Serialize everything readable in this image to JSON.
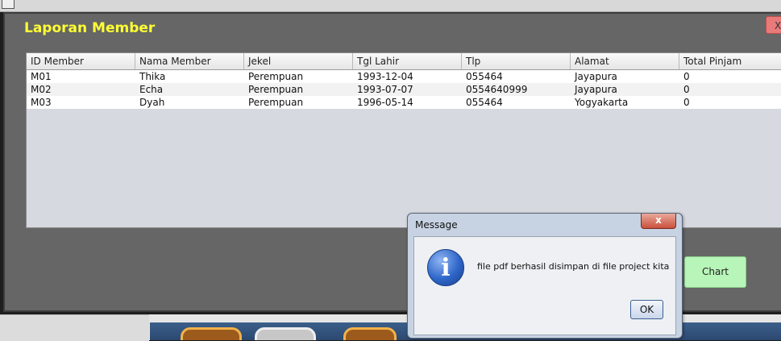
{
  "window": {
    "title": "Laporan Member",
    "close_label": "X"
  },
  "table": {
    "columns": [
      "ID Member",
      "Nama Member",
      "Jekel",
      "Tgl Lahir",
      "Tlp",
      "Alamat",
      "Total Pinjam"
    ],
    "rows": [
      [
        "M01",
        "Thika",
        "Perempuan",
        "1993-12-04",
        "055464",
        "Jayapura",
        "0"
      ],
      [
        "M02",
        "Echa",
        "Perempuan",
        "1993-07-07",
        "0554640999",
        "Jayapura",
        "0"
      ],
      [
        "M03",
        "Dyah",
        "Perempuan",
        "1996-05-14",
        "055464",
        "Yogyakarta",
        "0"
      ]
    ]
  },
  "buttons": {
    "chart_label": "Chart"
  },
  "dialog": {
    "title": "Message",
    "close_label": "x",
    "icon_glyph": "i",
    "message": "file pdf berhasil disimpan di file project kita",
    "ok_label": "OK"
  },
  "colors": {
    "title_yellow": "#ffff33",
    "frame_gray": "#666666",
    "chart_green": "#b8f5b8",
    "close_red": "#e87a7a"
  }
}
